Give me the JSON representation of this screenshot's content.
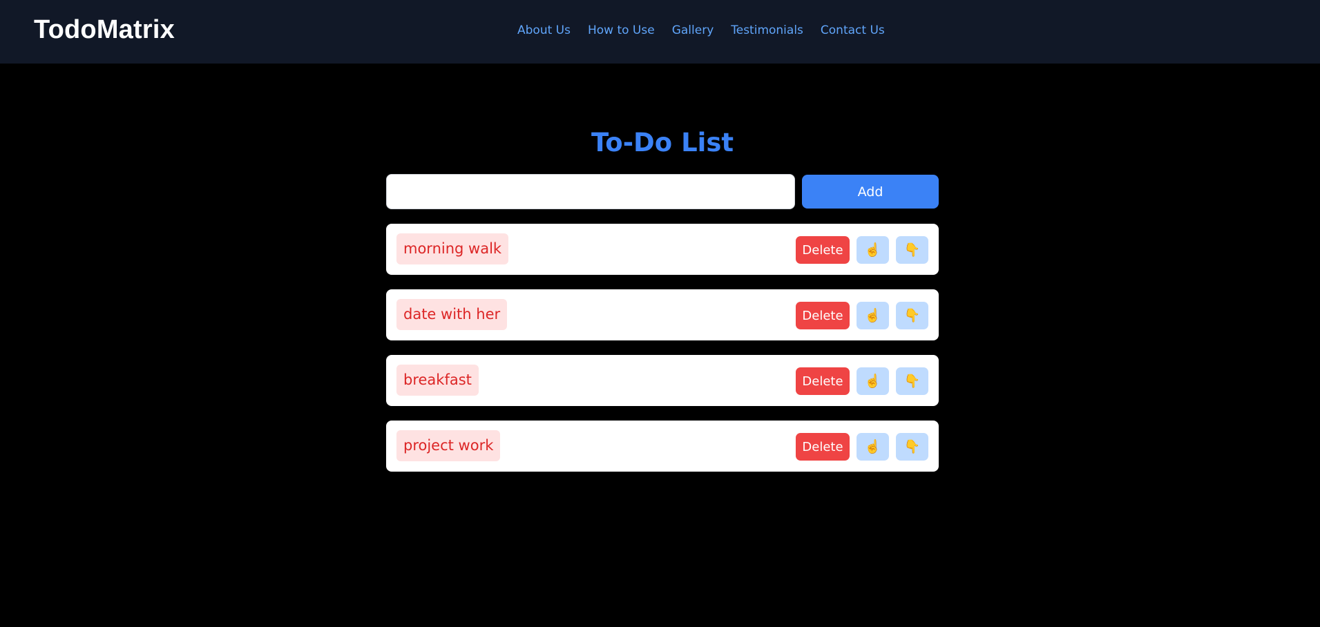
{
  "header": {
    "brand": "TodoMatrix",
    "nav": [
      {
        "label": "About Us"
      },
      {
        "label": "How to Use"
      },
      {
        "label": "Gallery"
      },
      {
        "label": "Testimonials"
      },
      {
        "label": "Contact Us"
      }
    ]
  },
  "main": {
    "title": "To-Do List",
    "input": {
      "value": "",
      "placeholder": ""
    },
    "add_label": "Add",
    "todos": [
      {
        "text": "morning walk",
        "delete_label": "Delete",
        "up_icon": "☝",
        "down_icon": "👇"
      },
      {
        "text": "date with her",
        "delete_label": "Delete",
        "up_icon": "☝",
        "down_icon": "👇"
      },
      {
        "text": "breakfast",
        "delete_label": "Delete",
        "up_icon": "☝",
        "down_icon": "👇"
      },
      {
        "text": "project work",
        "delete_label": "Delete",
        "up_icon": "☝",
        "down_icon": "👇"
      }
    ]
  },
  "colors": {
    "background": "#000000",
    "navbar": "#111827",
    "accent": "#3b82f6",
    "nav_link": "#60a5fa",
    "delete": "#ef4444",
    "todo_text": "#dc2626",
    "todo_text_bg": "#fee2e2",
    "vote_bg": "#bfdbfe"
  }
}
